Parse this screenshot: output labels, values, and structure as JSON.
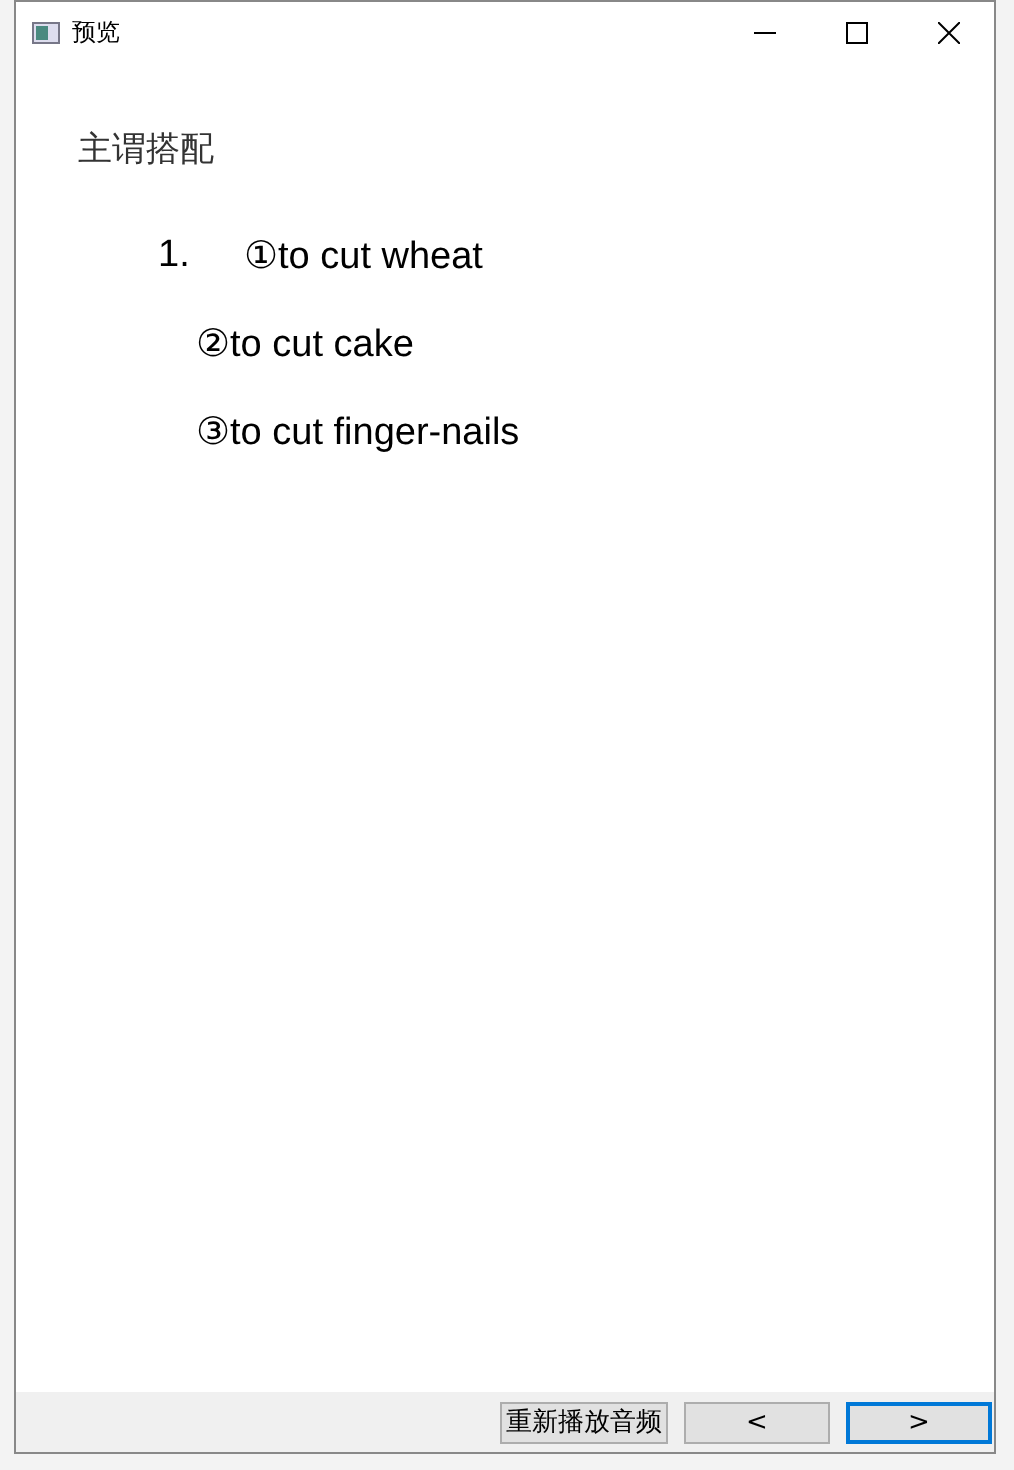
{
  "window": {
    "title": "预览"
  },
  "heading": "主谓搭配",
  "list": {
    "number": "1.",
    "items": [
      {
        "text": "①to cut wheat"
      },
      {
        "text": "②to cut cake"
      },
      {
        "text": "③to cut finger-nails"
      }
    ]
  },
  "buttons": [
    {
      "label": "重新播放音频",
      "focused": false
    },
    {
      "label": "<",
      "focused": false
    },
    {
      "label": ">",
      "focused": true
    }
  ]
}
